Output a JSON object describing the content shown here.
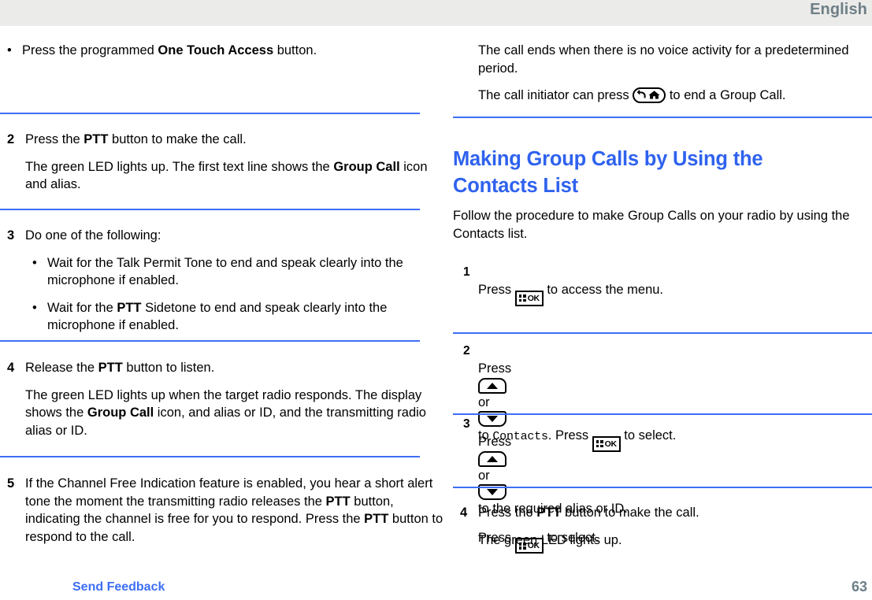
{
  "header": {
    "language": "English"
  },
  "footer": {
    "feedback_label": "Send Feedback",
    "page_number": "63"
  },
  "colors": {
    "heading_blue": "#2f62ee",
    "rule_blue": "#3d6ef5",
    "link_blue": "#3d6ef5",
    "header_gray": "#ebebe9",
    "muted_text": "#6e7f86"
  },
  "left_column": {
    "bullet_block": {
      "items": [
        {
          "text_before": "Press the programmed ",
          "bold": "One Touch Access",
          "text_after": " button."
        }
      ]
    },
    "steps": [
      {
        "number": "2",
        "lines": [
          {
            "text_before": "Press the ",
            "bold": "PTT",
            "text_after": " button to make the call."
          },
          {
            "text_before": "The green LED lights up. The first text line shows the ",
            "bold": "Group Call",
            "text_after": " icon and alias."
          }
        ]
      },
      {
        "number": "3",
        "intro": "Do one of the following:",
        "bullets": [
          {
            "text_before": "Wait for the Talk Permit Tone to end and speak clearly into the microphone if enabled.",
            "bold": "",
            "text_after": ""
          },
          {
            "text_before": "Wait for the ",
            "bold": "PTT",
            "text_after": " Sidetone to end and speak clearly into the microphone if enabled."
          }
        ]
      },
      {
        "number": "4",
        "lines": [
          {
            "text_before": "Release the ",
            "bold": "PTT",
            "text_after": " button to listen."
          },
          {
            "text_before": "The green LED lights up when the target radio responds. The display shows the ",
            "bold": "Group Call",
            "text_after": " icon, and alias or ID, and the transmitting radio alias or ID."
          }
        ]
      },
      {
        "number": "5",
        "segments": {
          "s1": "If the Channel Free Indication feature is enabled, you hear a short alert tone the moment the transmitting radio releases the ",
          "b1": "PTT",
          "s2": " button, indicating the channel is free for you to respond. Press the ",
          "b2": "PTT",
          "s3": " button to respond to the call."
        }
      }
    ]
  },
  "right_column": {
    "intro_paragraphs": [
      "The call ends when there is no voice activity for a predetermined period."
    ],
    "initiator_line": {
      "text_before": "The call initiator can press ",
      "icon": "back-home-key-icon",
      "text_after": " to end a Group Call."
    },
    "section_heading": "Making Group Calls by Using the Contacts List",
    "section_intro": "Follow the procedure to make Group Calls on your radio by using the Contacts list.",
    "steps": [
      {
        "number": "1",
        "parts": {
          "p1": "Press ",
          "icon1": "menu-ok-key-icon",
          "p2": " to access the menu."
        }
      },
      {
        "number": "2",
        "parts": {
          "p1": "Press ",
          "icon1": "up-arrow-key-icon",
          "p2": " or ",
          "icon2": "down-arrow-key-icon",
          "p3": " to ",
          "mono": "Contacts",
          "p4": ". Press ",
          "icon3": "menu-ok-key-icon",
          "p5": " to select."
        }
      },
      {
        "number": "3",
        "parts": {
          "p1": "Press ",
          "icon1": "up-arrow-key-icon",
          "p2": " or ",
          "icon2": "down-arrow-key-icon",
          "p3": " to the required alias or ID.",
          "p4": "Press ",
          "icon3": "menu-ok-key-icon",
          "p5": " to select."
        }
      },
      {
        "number": "4",
        "lines": [
          {
            "text_before": "Press the ",
            "bold": "PTT",
            "text_after": " button to make the call."
          },
          {
            "text_before": "The green LED lights up.",
            "bold": "",
            "text_after": ""
          }
        ]
      }
    ]
  }
}
